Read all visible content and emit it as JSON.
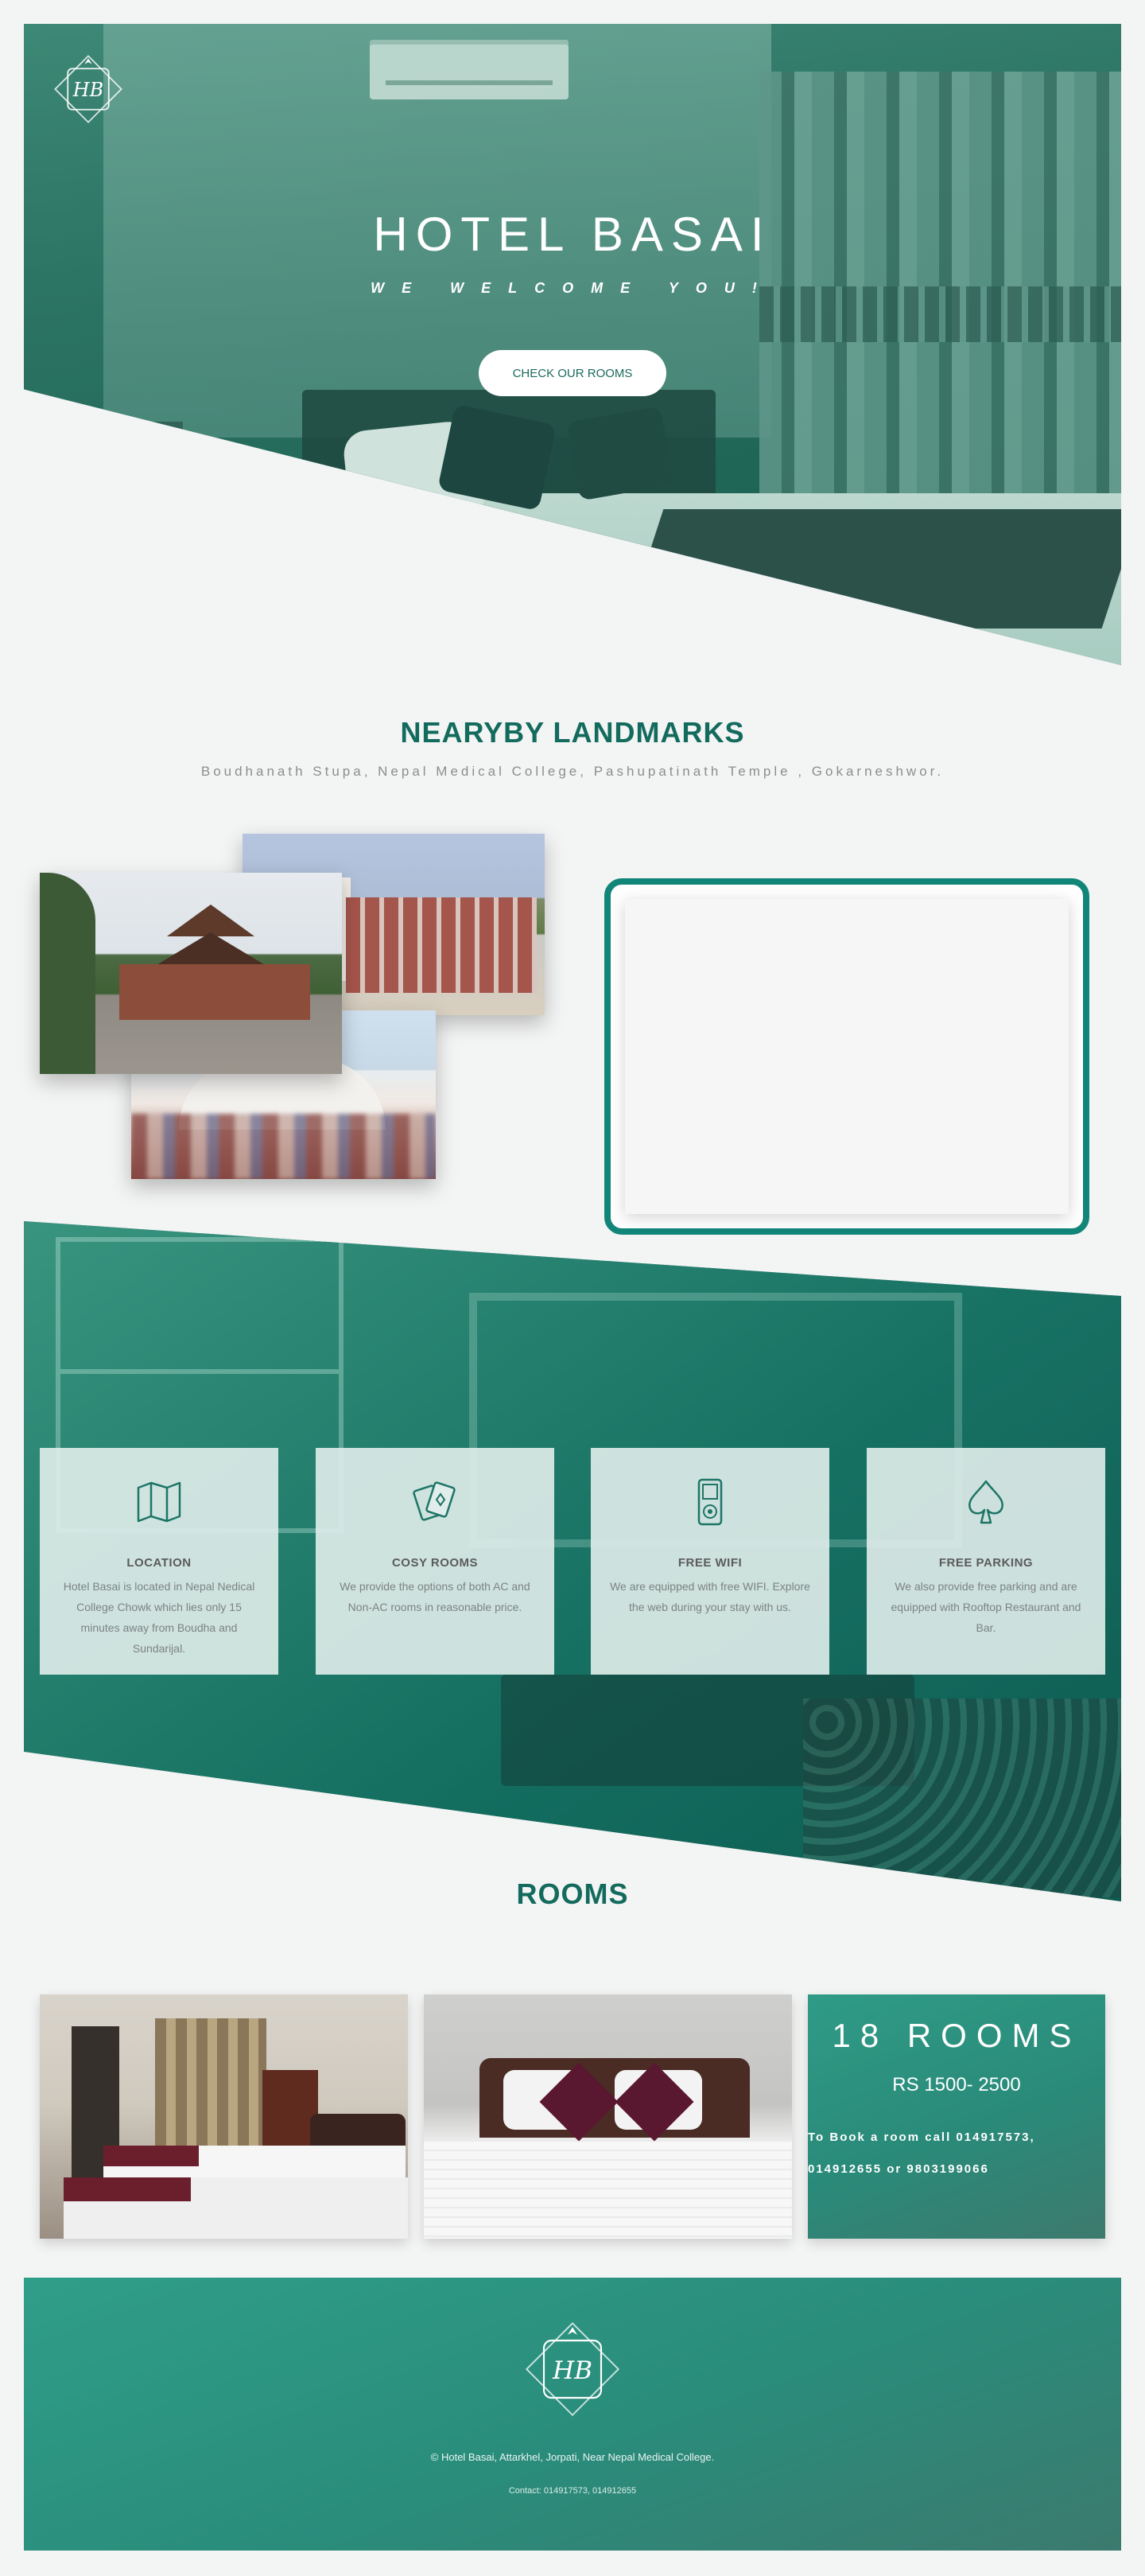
{
  "hero": {
    "title": "HOTEL BASAI",
    "subtitle": "WE WELCOME YOU!",
    "cta_label": "CHECK OUR ROOMS"
  },
  "landmarks": {
    "title": "NEARYBY LANDMARKS",
    "subtitle": "Boudhanath Stupa, Nepal Medical College, Pashupatinath Temple , Gokarneshwor."
  },
  "features": [
    {
      "icon": "map-icon",
      "title": "LOCATION",
      "text": "Hotel Basai is located in Nepal Nedical College Chowk which lies only 15 minutes away from Boudha and Sundarijal."
    },
    {
      "icon": "cards-icon",
      "title": "COSY ROOMS",
      "text": "We provide the options of both AC and Non-AC rooms in reasonable price."
    },
    {
      "icon": "ipod-icon",
      "title": "FREE WIFI",
      "text": "We are equipped with free WIFI. Explore the web during your stay with us."
    },
    {
      "icon": "spade-icon",
      "title": "FREE PARKING",
      "text": "We also provide free parking and are equipped with Rooftop Restaurant and Bar."
    }
  ],
  "rooms": {
    "title": "ROOMS",
    "count": "18 ROOMS",
    "price": "RS 1500- 2500",
    "booking": "To Book a room call 014917573, 014912655 or 9803199066"
  },
  "footer": {
    "copyright": "© Hotel Basai, Attarkhel, Jorpati, Near Nepal Medical College.",
    "contact": "Contact: 014917573, 014912655"
  },
  "colors": {
    "brand_teal": "#136b5d",
    "accent_teal": "#128579",
    "background": "#f3f4f4"
  }
}
